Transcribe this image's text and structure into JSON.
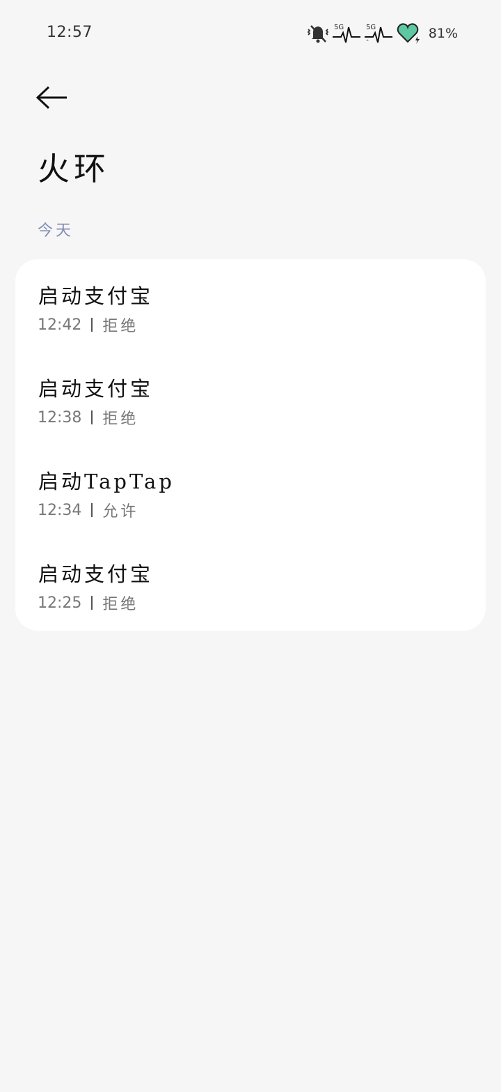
{
  "status_bar": {
    "time": "12:57",
    "signal_label_1": "5G",
    "signal_label_2": "5G",
    "battery": "81%",
    "icons": [
      "mute-bell-icon",
      "signal-5g-icon",
      "signal-5g-icon",
      "heart-battery-icon"
    ]
  },
  "header": {
    "back_icon": "arrow-left-icon",
    "title": "火环"
  },
  "section": {
    "label": "今天"
  },
  "records": [
    {
      "title": "启动支付宝",
      "time": "12:42",
      "result": "拒绝"
    },
    {
      "title": "启动支付宝",
      "time": "12:38",
      "result": "拒绝"
    },
    {
      "title": "启动TapTap",
      "time": "12:34",
      "result": "允许"
    },
    {
      "title": "启动支付宝",
      "time": "12:25",
      "result": "拒绝"
    }
  ],
  "colors": {
    "background": "#f6f6f6",
    "card": "#ffffff",
    "section_label": "#7f8bb3",
    "heart": "#5ec9a0"
  }
}
